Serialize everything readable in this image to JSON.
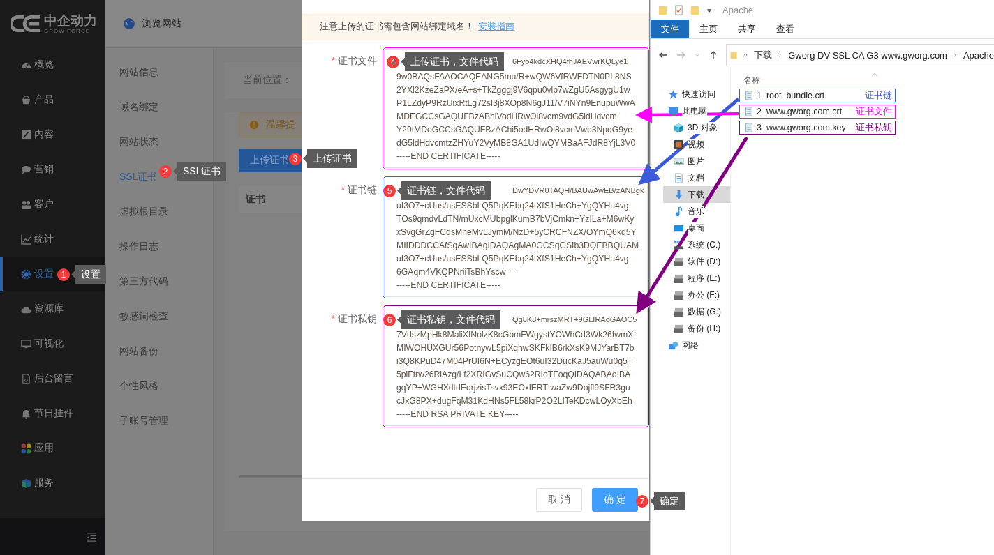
{
  "logo": {
    "name": "中企动力",
    "tagline": "GROW FORCE"
  },
  "topbar": {
    "browse": "浏览网站"
  },
  "nav": [
    {
      "label": "概览",
      "selected": false
    },
    {
      "label": "产品",
      "selected": false
    },
    {
      "label": "内容",
      "selected": false
    },
    {
      "label": "营销",
      "selected": false
    },
    {
      "label": "客户",
      "selected": false
    },
    {
      "label": "统计",
      "selected": false
    },
    {
      "label": "设置",
      "selected": true
    },
    {
      "label": "资源库",
      "selected": false
    },
    {
      "label": "可视化",
      "selected": false
    },
    {
      "label": "后台留言",
      "selected": false
    },
    {
      "label": "节日挂件",
      "selected": false
    },
    {
      "label": "应用",
      "selected": false
    },
    {
      "label": "服务",
      "selected": false
    }
  ],
  "submenu": [
    {
      "label": "网站信息",
      "selected": false
    },
    {
      "label": "域名绑定",
      "selected": false
    },
    {
      "label": "网站状态",
      "selected": false
    },
    {
      "label": "SSL证书",
      "selected": true
    },
    {
      "label": "虚拟根目录",
      "selected": false
    },
    {
      "label": "操作日志",
      "selected": false
    },
    {
      "label": "第三方代码",
      "selected": false
    },
    {
      "label": "敏感词检查",
      "selected": false
    },
    {
      "label": "网站备份",
      "selected": false
    },
    {
      "label": "个性风格",
      "selected": false
    },
    {
      "label": "子账号管理",
      "selected": false
    }
  ],
  "main": {
    "breadcrumb": "当前位置：",
    "tip": "温馨提",
    "upload_button": "上传证书",
    "table_header": "证书"
  },
  "modal": {
    "notice": "注意上传的证书需包含网站绑定域名！",
    "link": "安装指南",
    "fields": [
      {
        "label": "证书文件",
        "required": true,
        "marker": "*",
        "color": "#ff00ff",
        "fragment": "6Fyo4kdcXHQ4fhJAEVwrKQLye1",
        "lines": [
          "9w0BAQsFAAOCAQEANG5mu/R+wQW6VfRWFDTN0PL8NS",
          "2YXl2KzeZaPX/eA+s+TkZgggj9V6qpu0vlp7wZgU5AsgygU1w",
          "P1LZdyP9RzUixRtLg72sI3j8XOp8N6gJ11/V7iNYn9EnupuWwA",
          "MDEGCCsGAQUFBzABhiVodHRwOi8vcm9vdG5ldHdvcm",
          "Y29tMDoGCCsGAQUFBzAChi5odHRwOi8vcmVwb3NpdG9ye",
          "dG5ldHdvcmtzZHYuY2VyMB8GA1UdIwQYMBaAFJdR8YjL3V0",
          "-----END CERTIFICATE-----"
        ]
      },
      {
        "label": "证书链",
        "required": true,
        "marker": "*",
        "color": "#3b5bdb",
        "fragment": "DwYDVR0TAQH/BAUwAwEB/zANBgk",
        "lines": [
          "uI3O7+cUus/usESSbLQ5PqKEbq24IXfS1HeCh+YgQYHu4vg",
          "TOs9qmdvLdTN/mUxcMUbpglKumB7bVjCmkn+YzILa+M6wKy",
          "xSvgGrZgFCdsMneMvLJymM/NzD+5yCRCFNZX/OYmQ6kd5Y",
          "MIIDDDCCAfSgAwIBAgIDAQAgMA0GCSqGSIb3DQEBBQUAM",
          "uI3O7+cUus/usESSbLQ5PqKEbq24IXfS1HeCh+YgQYHu4vg",
          "6GAqm4VKQPNriiTsBhYscw==",
          "-----END CERTIFICATE-----"
        ]
      },
      {
        "label": "证书私钥",
        "required": true,
        "marker": "*",
        "color": "#800080",
        "fragment": "Qg8K8+mrszMRT+9GLIRAoGAOC5",
        "lines": [
          "7VdszMpHk8MaliXINolzK8cGbmFWgystYOWhCd3Wk26IwmX",
          "MIWOHUXGUr56PotnywL5piXqhwSKFkIB6rkXsK9MJYarBT7b",
          "i3Q8KPuD47M04PrUI6N+ECyzgEOt6uI32DucKaJ5auWu0q5T",
          "5piFtrw26RiAzg/Lf2XRIGvSuCQw62RIoTFoqQIDAQABAoIBA",
          "gqYP+WGHXdtdEqrjzisTsvx93EOxlERTIwaZw9Dojfl9SFR3gu",
          "cJxG8PX+dugFqM31KdHNs5FL58krP2O2LITeKDcwLOyXbEh",
          "-----END RSA PRIVATE KEY-----"
        ]
      }
    ],
    "buttons": [
      {
        "label": "取 消",
        "kind": "default"
      },
      {
        "label": "确 定",
        "kind": "primary"
      }
    ]
  },
  "steps": [
    {
      "number": "1",
      "label": "设置"
    },
    {
      "number": "2",
      "label": "SSL证书"
    },
    {
      "number": "3",
      "label": "上传证书"
    },
    {
      "number": "4",
      "label": "上传证书，文件代码"
    },
    {
      "number": "5",
      "label": "证书链，文件代码"
    },
    {
      "number": "6",
      "label": "证书私钥，文件代码"
    },
    {
      "number": "7",
      "label": "确定"
    }
  ],
  "explorer": {
    "title": "Apache",
    "ribbon": [
      {
        "label": "文件",
        "selected": true
      },
      {
        "label": "主页",
        "selected": false
      },
      {
        "label": "共享",
        "selected": false
      },
      {
        "label": "查看",
        "selected": false
      }
    ],
    "path": [
      "下载",
      "Gworg DV SSL CA G3 www.gworg.com",
      "Apache"
    ],
    "column": "名称",
    "tree": [
      {
        "label": "快速访问",
        "kind": "star",
        "selected": false
      },
      {
        "label": "此电脑",
        "kind": "pc",
        "selected": false,
        "children": [
          {
            "label": "3D 对象",
            "kind": "cube",
            "selected": false
          },
          {
            "label": "视频",
            "kind": "video",
            "selected": false
          },
          {
            "label": "图片",
            "kind": "picture",
            "selected": false
          },
          {
            "label": "文档",
            "kind": "document",
            "selected": false
          },
          {
            "label": "下载",
            "kind": "download",
            "selected": true
          },
          {
            "label": "音乐",
            "kind": "music",
            "selected": false
          },
          {
            "label": "桌面",
            "kind": "desktop",
            "selected": false
          },
          {
            "label": "系统 (C:)",
            "kind": "system-drive",
            "selected": false
          },
          {
            "label": "软件 (D:)",
            "kind": "drive",
            "selected": false
          },
          {
            "label": "程序 (E:)",
            "kind": "drive",
            "selected": false
          },
          {
            "label": "办公 (F:)",
            "kind": "drive",
            "selected": false
          },
          {
            "label": "数据 (G:)",
            "kind": "drive",
            "selected": false
          },
          {
            "label": "备份 (H:)",
            "kind": "drive",
            "selected": false
          }
        ]
      },
      {
        "label": "网络",
        "kind": "network",
        "selected": false
      }
    ],
    "files": [
      {
        "name": "1_root_bundle.crt",
        "tag": "证书链",
        "color": "#3b5bdb"
      },
      {
        "name": "2_www.gworg.com.crt",
        "tag": "证书文件",
        "color": "#ff00ff"
      },
      {
        "name": "3_www.gworg.com.key",
        "tag": "证书私钥",
        "color": "#800080"
      }
    ]
  }
}
